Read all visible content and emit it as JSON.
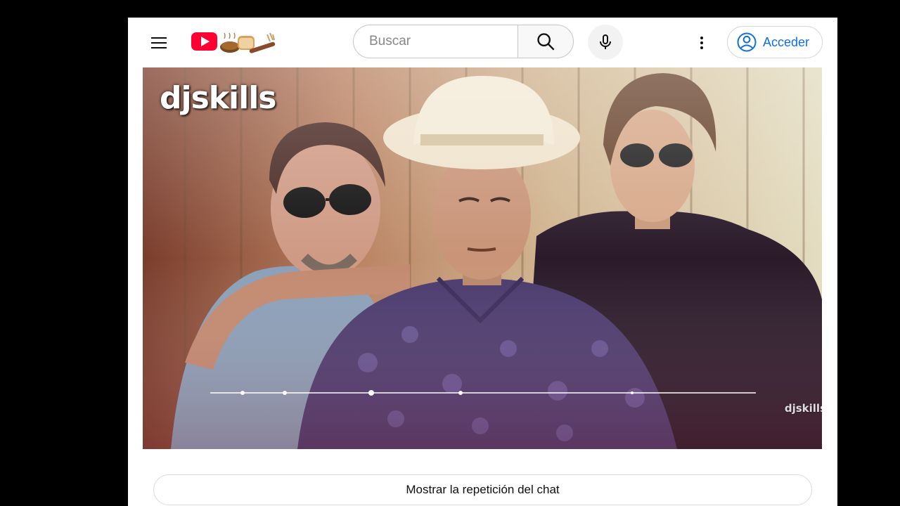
{
  "header": {
    "menu_icon": "hamburger-menu-icon",
    "logo_icon": "youtube-logo-with-bread-icon",
    "search": {
      "placeholder": "Buscar",
      "value": ""
    },
    "search_icon": "search-icon",
    "mic_icon": "microphone-icon",
    "more_icon": "vertical-dots-icon",
    "signin": {
      "label": "Acceder",
      "icon": "account-circle-icon"
    }
  },
  "video": {
    "logo_text": "djskills",
    "watermark_text": "djskills"
  },
  "chat": {
    "replay_label": "Mostrar la repetición del chat"
  },
  "colors": {
    "background": "#000000",
    "page": "#ffffff",
    "youtube_red": "#ff0033",
    "link_blue": "#0f6fde"
  }
}
